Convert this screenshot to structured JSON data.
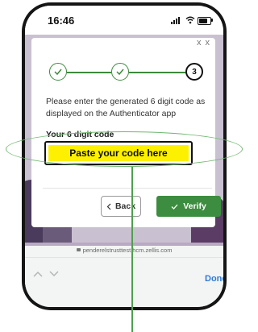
{
  "status_bar": {
    "time": "16:46"
  },
  "modal": {
    "close_label": "x x",
    "steps": [
      {
        "state": "done",
        "label": ""
      },
      {
        "state": "done",
        "label": ""
      },
      {
        "state": "current",
        "label": "3"
      }
    ],
    "instructions": "Please enter the generated 6 digit code as displayed on the Authenticator app",
    "code_label": "Your 6 digit code",
    "code_input": {
      "placeholder": "Paste your code here",
      "value": ""
    },
    "back_label": "Back",
    "verify_label": "Verify"
  },
  "browser": {
    "url": "penderelstrusttest.hcm.zellis.com",
    "done_label": "Done"
  },
  "colors": {
    "accent_green": "#3c8d3f",
    "input_highlight": "#fdf000",
    "done_blue": "#2f7ad8"
  },
  "icons": [
    "checkmark-icon",
    "chevron-left-icon",
    "chevron-up-icon",
    "chevron-down-icon",
    "lock-icon",
    "signal-icon",
    "wifi-icon",
    "battery-icon"
  ]
}
